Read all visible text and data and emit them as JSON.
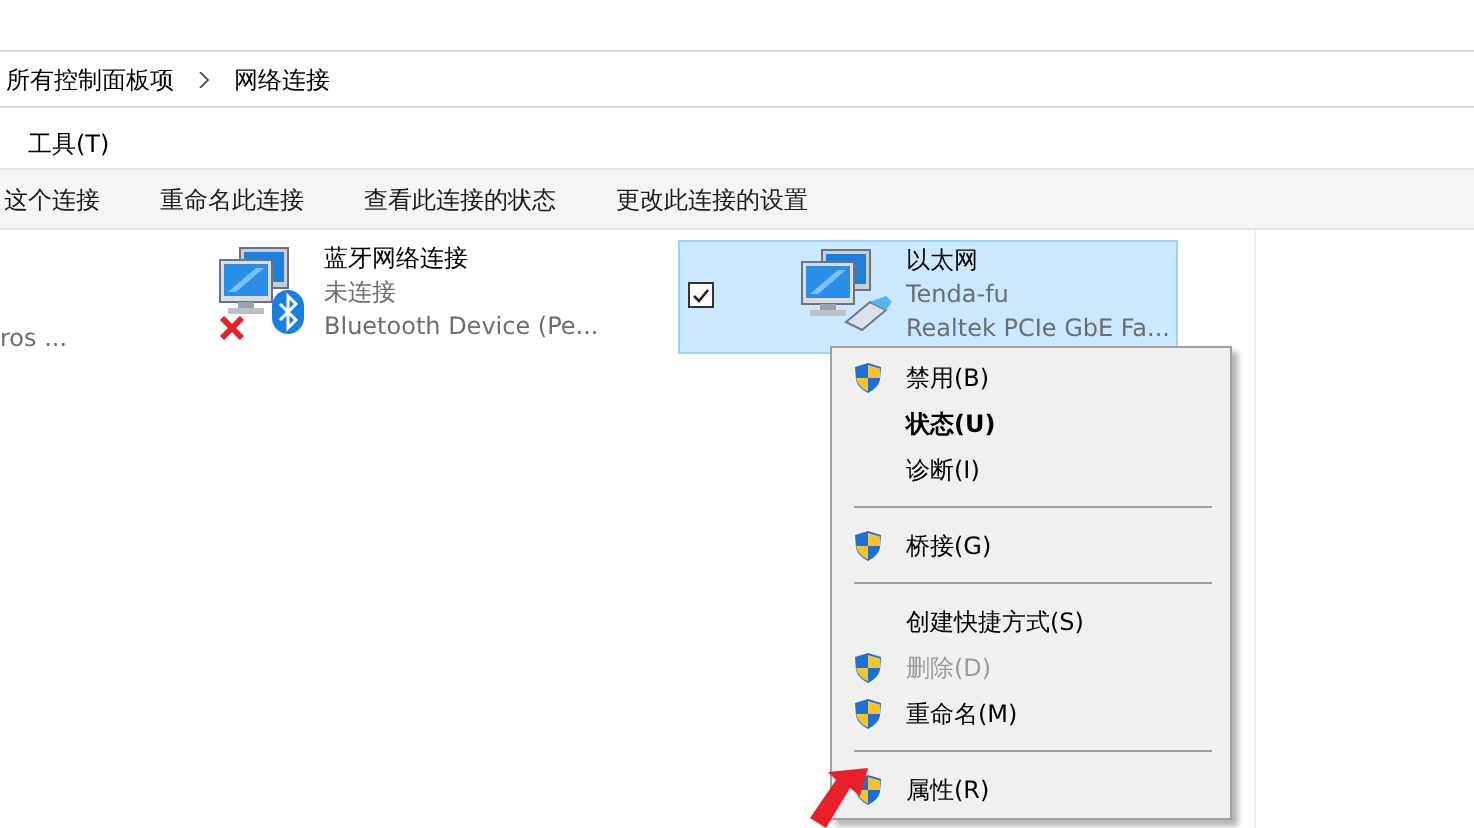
{
  "breadcrumb": [
    {
      "label": "所有控制面板项"
    },
    {
      "label": "网络连接"
    }
  ],
  "menu_bar": [
    {
      "label": "工具(T)"
    }
  ],
  "toolbar": [
    {
      "label": "这个连接"
    },
    {
      "label": "重命名此连接"
    },
    {
      "label": "查看此连接的状态"
    },
    {
      "label": "更改此连接的设置"
    }
  ],
  "partial_item": {
    "detail": "ros ..."
  },
  "connections": [
    {
      "name": "蓝牙网络连接",
      "status": "未连接",
      "device": "Bluetooth Device (Pe...",
      "kind": "bluetooth",
      "disconnected": true,
      "selected": false,
      "checked": false
    },
    {
      "name": "以太网",
      "status": "Tenda-fu",
      "device": "Realtek PCIe GbE Fa...",
      "kind": "ethernet",
      "disconnected": false,
      "selected": true,
      "checked": true
    }
  ],
  "context_menu": [
    {
      "kind": "item",
      "label": "禁用(B)",
      "shield": true,
      "default": false,
      "disabled": false
    },
    {
      "kind": "item",
      "label": "状态(U)",
      "shield": false,
      "default": true,
      "disabled": false
    },
    {
      "kind": "item",
      "label": "诊断(I)",
      "shield": false,
      "default": false,
      "disabled": false
    },
    {
      "kind": "separator"
    },
    {
      "kind": "item",
      "label": "桥接(G)",
      "shield": true,
      "default": false,
      "disabled": false
    },
    {
      "kind": "separator"
    },
    {
      "kind": "item",
      "label": "创建快捷方式(S)",
      "shield": false,
      "default": false,
      "disabled": false
    },
    {
      "kind": "item",
      "label": "删除(D)",
      "shield": true,
      "default": false,
      "disabled": true
    },
    {
      "kind": "item",
      "label": "重命名(M)",
      "shield": true,
      "default": false,
      "disabled": false
    },
    {
      "kind": "separator"
    },
    {
      "kind": "item",
      "label": "属性(R)",
      "shield": true,
      "default": false,
      "disabled": false
    }
  ]
}
